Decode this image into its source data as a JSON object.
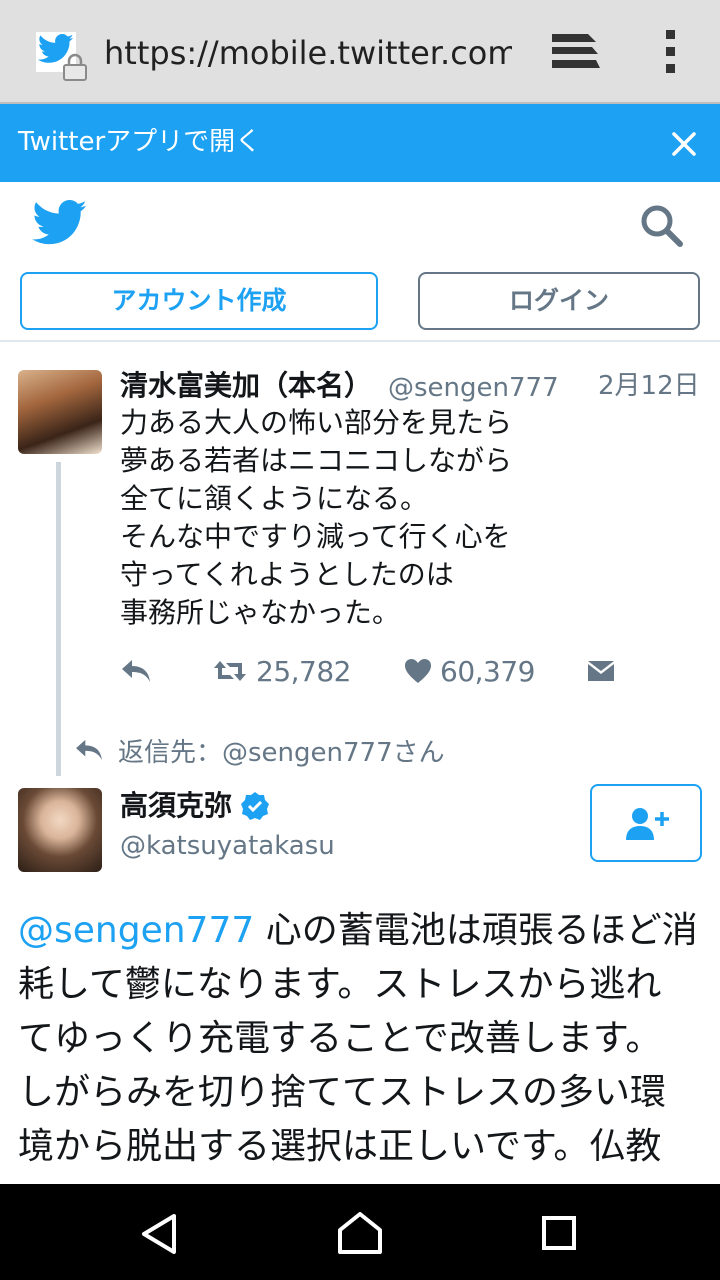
{
  "browser": {
    "url": "https://mobile.twitter.com",
    "favicon": "twitter-bird-icon",
    "secure": "lock-icon"
  },
  "banner": {
    "text": "Twitterアプリで開く",
    "close": "close-icon",
    "color": "#1da1f2"
  },
  "header": {
    "logo": "twitter-bird-icon",
    "search": "search-icon",
    "signup_label": "アカウント作成",
    "login_label": "ログイン"
  },
  "tweet1": {
    "name": "清水富美加（本名）",
    "handle": "@sengen777",
    "date": "2月12日",
    "lines": [
      "力ある大人の怖い部分を見たら",
      "夢ある若者はニコニコしながら",
      "全てに頷くようになる。",
      "そんな中ですり減って行く心を",
      "守ってくれようとしたのは",
      "事務所じゃなかった。"
    ],
    "retweets": "25,782",
    "likes": "60,379"
  },
  "reply_context": "返信先：@sengen777さん",
  "tweet2": {
    "name": "高須克弥",
    "handle": "@katsuyatakasu",
    "verified": "verified-badge-icon",
    "mention": "@sengen777",
    "line1_rest": " 心の蓄電池は頑張るほど消",
    "lines": [
      "耗して鬱になります。ストレスから逃れ",
      "てゆっくり充電することで改善します。",
      "しがらみを切り捨ててストレスの多い環",
      "境から脱出する選択は正しいです。仏教"
    ]
  },
  "colors": {
    "accent": "#1da1f2",
    "secondary_text": "#657786",
    "thread_line": "#cdd6dd"
  }
}
